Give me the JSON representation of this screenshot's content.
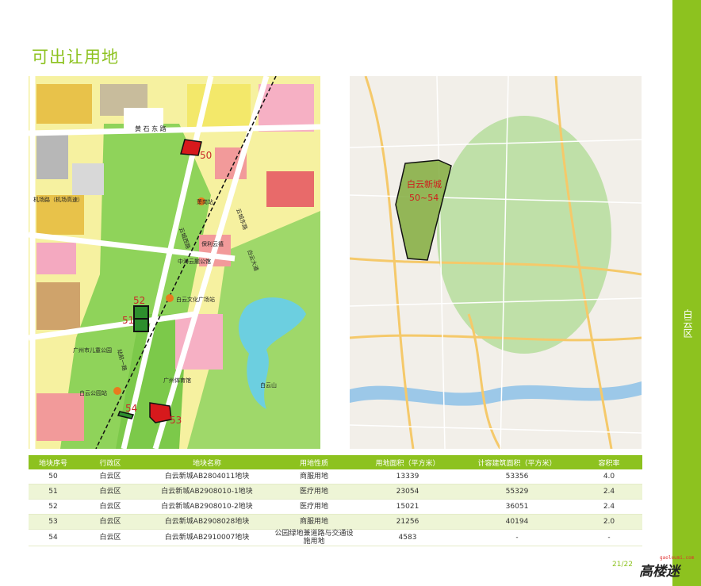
{
  "page": {
    "title": "可出让用地",
    "side_label": "白云区",
    "page_number": "21/22",
    "logo_text": "高楼迷",
    "logo_sub": "gaoloumi.com",
    "accent_color": "#8dc21f"
  },
  "left_map": {
    "labels": {
      "road_huangshi": "黄 石 东 路",
      "road_jichang": "机场路（机场高速）",
      "road_yuncheng_w": "云城西路",
      "road_yuncheng_e": "云城东路",
      "road_baiyun_ave": "白云大道",
      "road_zhanqian": "站前一路",
      "station_xiaogang": "萧岗站",
      "station_wenhua": "白云文化广场站",
      "station_park": "白云公园站",
      "poi_baoli": "保利云禧",
      "poi_zhonghai": "中海云麓公馆",
      "poi_children_park": "广州市儿童公园",
      "poi_stadium": "广州体育馆",
      "poi_mountain": "白云山"
    },
    "plots": [
      {
        "id": "50",
        "color": "#d7191c"
      },
      {
        "id": "51",
        "color": "#2d8f2d"
      },
      {
        "id": "52",
        "color": "#2d8f2d"
      },
      {
        "id": "53",
        "color": "#d7191c"
      },
      {
        "id": "54",
        "color": "#2d8f2d"
      }
    ]
  },
  "right_map": {
    "area_label": "白云新城",
    "area_range": "50~54",
    "area_color": "#7aa832"
  },
  "table": {
    "headers": [
      "地块序号",
      "行政区",
      "地块名称",
      "用地性质",
      "用地面积（平方米）",
      "计容建筑面积（平方米）",
      "容积率"
    ],
    "rows": [
      [
        "50",
        "白云区",
        "白云新城AB2804011地块",
        "商服用地",
        "13339",
        "53356",
        "4.0"
      ],
      [
        "51",
        "白云区",
        "白云新城AB2908010-1地块",
        "医疗用地",
        "23054",
        "55329",
        "2.4"
      ],
      [
        "52",
        "白云区",
        "白云新城AB2908010-2地块",
        "医疗用地",
        "15021",
        "36051",
        "2.4"
      ],
      [
        "53",
        "白云区",
        "白云新城AB2908028地块",
        "商服用地",
        "21256",
        "40194",
        "2.0"
      ],
      [
        "54",
        "白云区",
        "白云新城AB2910007地块",
        "公园绿地兼道路与交通设施用地",
        "4583",
        "-",
        "-"
      ]
    ]
  }
}
